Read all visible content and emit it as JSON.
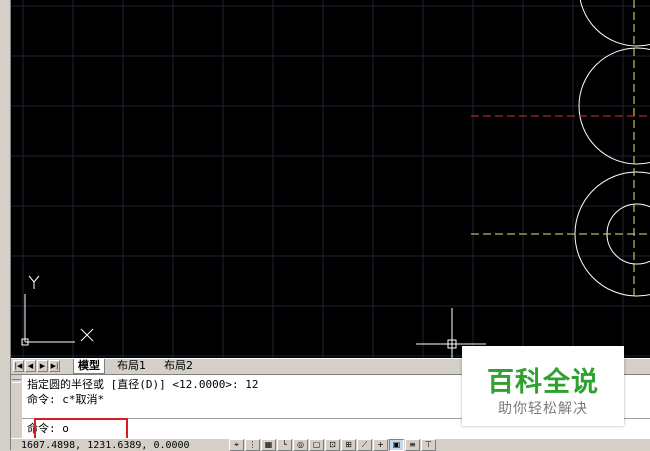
{
  "layout_tabs": [
    "模型",
    "布局1",
    "布局2"
  ],
  "nav_buttons": [
    "|◀",
    "◀",
    "▶",
    "▶|"
  ],
  "command_history": [
    "指定圆的半径或 [直径(D)] <12.0000>: 12",
    "命令: c*取消*"
  ],
  "command_prompt": "命令: o",
  "status": {
    "coordinates": "1607.4898, 1231.6389, 0.0000",
    "buttons": [
      "snap",
      "grid",
      "ortho",
      "polar",
      "osnap",
      "otrack",
      "ducs",
      "dyn",
      "lwt",
      "model",
      "qp",
      "sc",
      "am"
    ]
  },
  "ucs": {
    "y_label": "Y",
    "x_label": "X"
  },
  "watermark": {
    "title": "百科全说",
    "subtitle": "助你轻松解决"
  },
  "colors": {
    "canvas_bg": "#000000",
    "grid": "#1c2433",
    "geometry": "#ffffff",
    "center_line_red": "#d32f2f",
    "center_line_yellow": "#e8e088",
    "highlight_box": "#d21e1e",
    "watermark_green": "#2fa12f"
  }
}
